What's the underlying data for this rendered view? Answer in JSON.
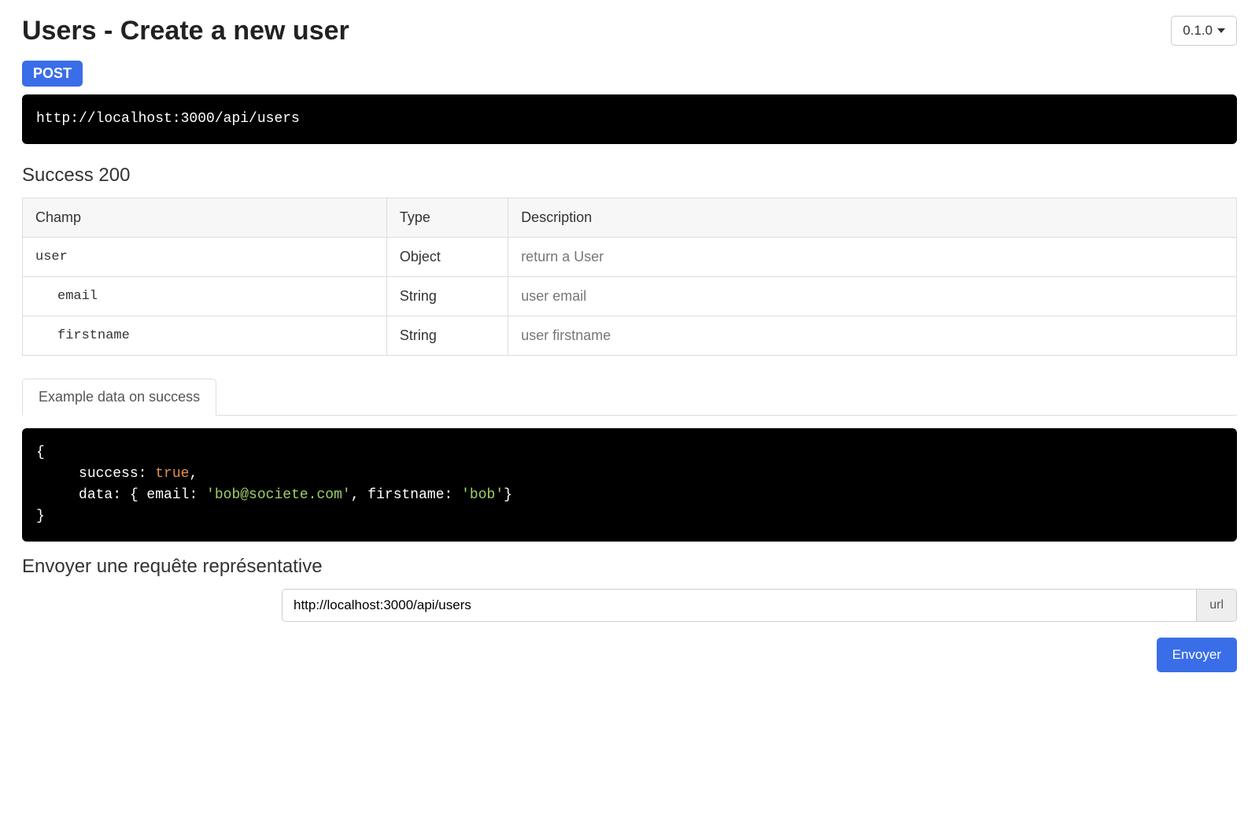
{
  "header": {
    "title": "Users - Create a new user",
    "version": "0.1.0"
  },
  "request": {
    "method": "POST",
    "url": "http://localhost:3000/api/users"
  },
  "success": {
    "heading": "Success 200",
    "columns": {
      "field": "Champ",
      "type": "Type",
      "description": "Description"
    },
    "rows": [
      {
        "field": "user",
        "indent": 0,
        "type": "Object",
        "description": "return a User"
      },
      {
        "field": "email",
        "indent": 1,
        "type": "String",
        "description": "user email"
      },
      {
        "field": "firstname",
        "indent": 1,
        "type": "String",
        "description": "user firstname"
      }
    ]
  },
  "exampleTab": {
    "label": "Example data on success"
  },
  "exampleCode": {
    "line1": "{",
    "line2_indent": "     ",
    "line2_key": "success: ",
    "line2_val": "true",
    "line2_tail": ",",
    "line3_indent": "     ",
    "line3_head": "data: { email: ",
    "line3_str1": "'bob@societe.com'",
    "line3_mid": ", firstname: ",
    "line3_str2": "'bob'",
    "line3_tail": "}",
    "line4": "}"
  },
  "sampleRequest": {
    "heading": "Envoyer une requête représentative",
    "url_value": "http://localhost:3000/api/users",
    "url_addon": "url",
    "send_label": "Envoyer"
  }
}
